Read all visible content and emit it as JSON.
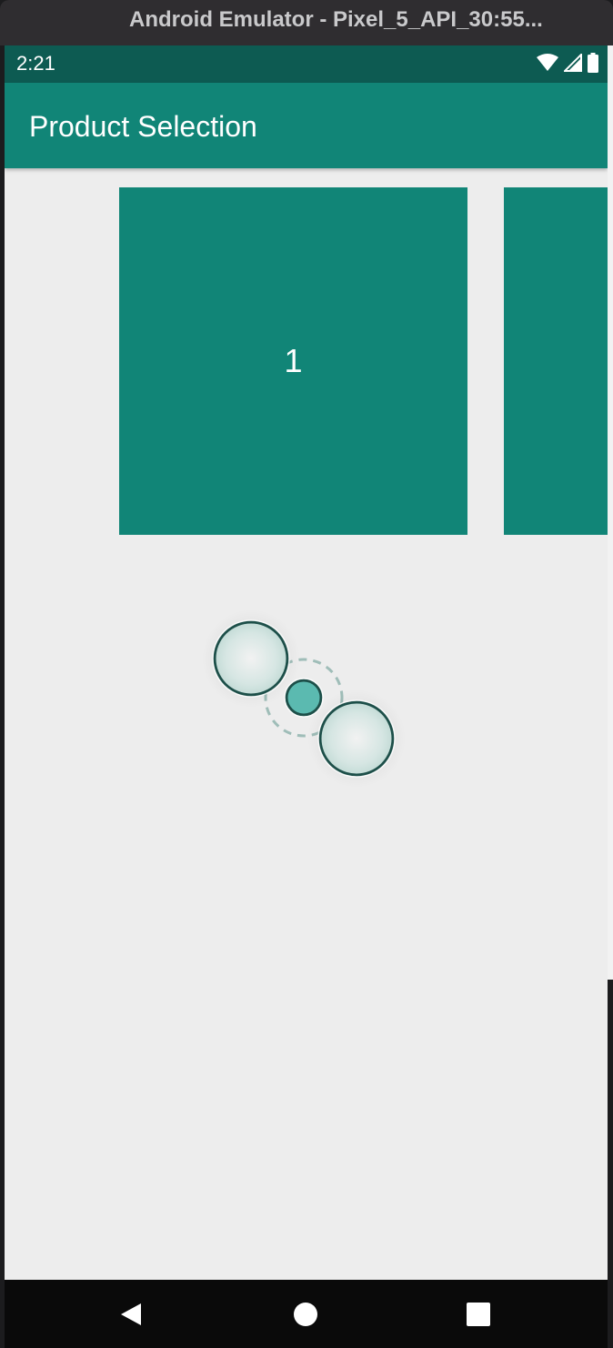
{
  "window": {
    "title": "Android Emulator - Pixel_5_API_30:55..."
  },
  "status_bar": {
    "time": "2:21",
    "icons": [
      "wifi-icon",
      "cellular-signal-icon",
      "battery-icon"
    ]
  },
  "app_bar": {
    "title": "Product Selection"
  },
  "carousel": {
    "cards": [
      {
        "label": "1"
      },
      {
        "label": ""
      }
    ]
  },
  "gesture_overlay": {
    "type": "pinch-zoom",
    "touch_points": 2
  },
  "nav_bar": {
    "buttons": [
      "back-icon",
      "home-icon",
      "recents-icon"
    ]
  },
  "colors": {
    "primary": "#118577",
    "primary_dark": "#0d5b52",
    "background": "#ededed",
    "nav_bar": "#0a0a0a"
  }
}
